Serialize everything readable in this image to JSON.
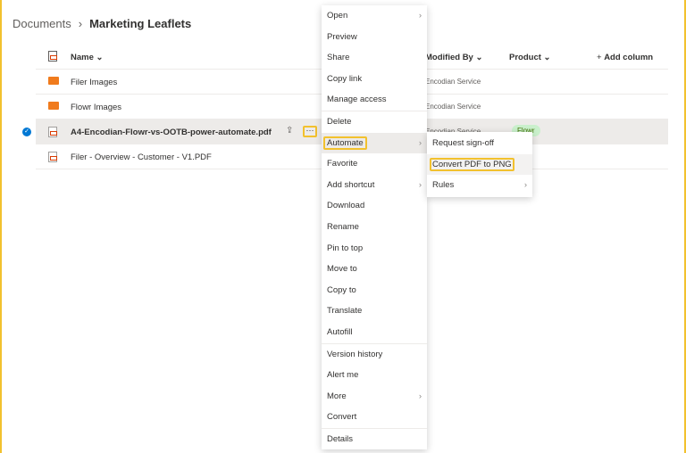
{
  "breadcrumb": {
    "root": "Documents",
    "current": "Marketing Leaflets"
  },
  "columns": {
    "name": "Name",
    "modified_by": "Modified By",
    "product": "Product",
    "add_column": "Add column"
  },
  "rows": [
    {
      "name": "Filer Images",
      "type": "folder",
      "modified_by": "Encodian Service",
      "product": ""
    },
    {
      "name": "Flowr Images",
      "type": "folder",
      "modified_by": "Encodian Service",
      "product": ""
    },
    {
      "name": "A4-Encodian-Flowr-vs-OOTB-power-automate.pdf",
      "type": "pdf",
      "modified_by": "Encodian Service",
      "product": "Flowr",
      "selected": true
    },
    {
      "name": "Filer - Overview - Customer - V1.PDF",
      "type": "pdf",
      "modified_by": "",
      "product": ""
    }
  ],
  "context_menu": [
    "Open",
    "Preview",
    "Share",
    "Copy link",
    "Manage access",
    "Delete",
    "Automate",
    "Favorite",
    "Add shortcut",
    "Download",
    "Rename",
    "Pin to top",
    "Move to",
    "Copy to",
    "Translate",
    "Autofill",
    "Version history",
    "Alert me",
    "More",
    "Convert",
    "Details"
  ],
  "submenu": [
    "Request sign-off",
    "Convert PDF to PNG",
    "Rules"
  ],
  "colors": {
    "highlight": "#f2c12e",
    "accent": "#0078d4",
    "folder": "#f07b1d"
  }
}
